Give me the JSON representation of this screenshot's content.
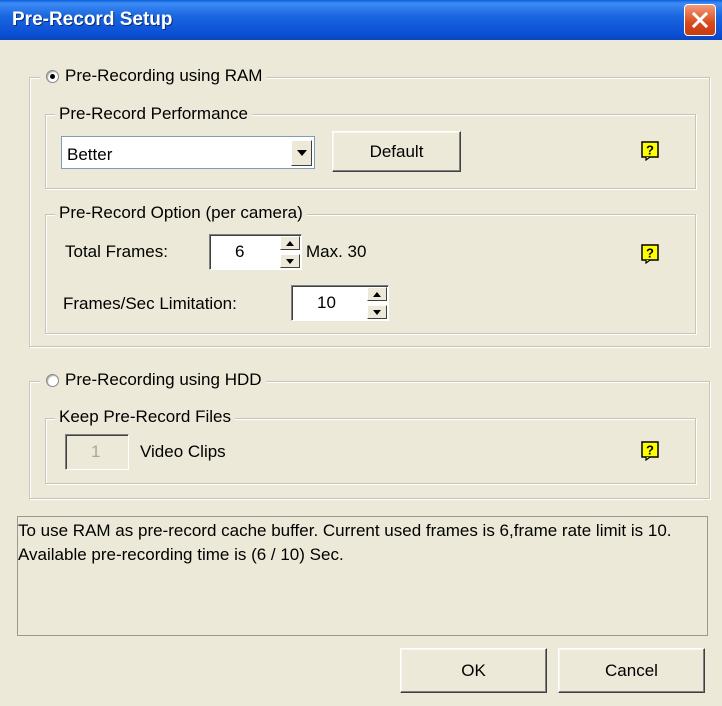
{
  "window": {
    "title": "Pre-Record Setup"
  },
  "ram_option": {
    "label": "Pre-Recording using RAM",
    "selected": true,
    "performance": {
      "legend": "Pre-Record Performance",
      "value": "Better",
      "default_button": "Default"
    },
    "options": {
      "legend": "Pre-Record Option (per camera)",
      "total_frames_label": "Total Frames:",
      "total_frames_value": "6",
      "max_label": "Max. 30",
      "fps_label": "Frames/Sec Limitation:",
      "fps_value": "10"
    }
  },
  "hdd_option": {
    "label": "Pre-Recording using HDD",
    "selected": false,
    "keep": {
      "legend": "Keep Pre-Record Files",
      "value": "1",
      "unit": "Video Clips"
    }
  },
  "info": {
    "text": "To use RAM as pre-record cache buffer. Current used frames is 6,frame rate limit is 10. Available pre-recording time is (6 / 10) Sec."
  },
  "footer": {
    "ok": "OK",
    "cancel": "Cancel"
  },
  "icons": {
    "help": "help-icon",
    "close": "close-icon"
  },
  "colors": {
    "titlebar": "#0B4FD4",
    "close": "#D84A1B",
    "dialog_bg": "#ECE9D8",
    "help_yellow": "#FFFF00"
  }
}
